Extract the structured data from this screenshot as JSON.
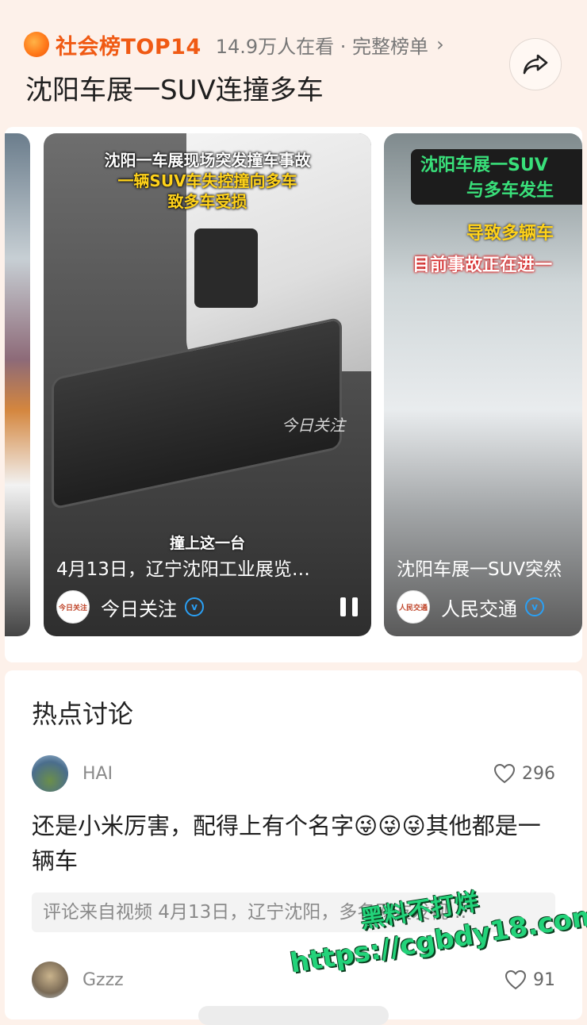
{
  "header": {
    "rank_label": "社会榜TOP14",
    "viewers": "14.9万人在看 · 完整榜单",
    "chevron": "›",
    "title": "沈阳车展一SUV连撞多车"
  },
  "cards": {
    "main": {
      "overlay_line1": "沈阳一车展现场突发撞车事故",
      "overlay_line2": "一辆SUV车失控撞向多车",
      "overlay_line3": "致多车受损",
      "watermark": "今日关注",
      "subtitle": "撞上这一台",
      "caption": "4月13日，辽宁沈阳工业展览…",
      "author": "今日关注",
      "author_avatar_text": "今日关注"
    },
    "next": {
      "overlay_line1": "沈阳车展一SUV",
      "overlay_line2": "与多车发生",
      "overlay_line3": "导致多辆车",
      "overlay_line4": "目前事故正在进一",
      "caption": "沈阳车展一SUV突然",
      "author": "人民交通",
      "author_avatar_text": "人民交通"
    },
    "verified_mark": "v"
  },
  "discussion": {
    "title": "热点讨论",
    "comments": [
      {
        "user": "HAI",
        "likes": "296",
        "text": "还是小米厉害，配得上有个名字😜😜😜其他都是一辆车",
        "source": "评论来自视频 4月13日，辽宁沈阳，多名网友发视…"
      },
      {
        "user": "Gzzz",
        "likes": "91"
      }
    ]
  },
  "promo": {
    "line1": "黑料不打烊",
    "line2": "https://cgbdy18.com"
  },
  "colors": {
    "accent": "#f05a14",
    "background": "#fdf1ea",
    "verified": "#2aa0f5",
    "promo": "#23d37a"
  }
}
